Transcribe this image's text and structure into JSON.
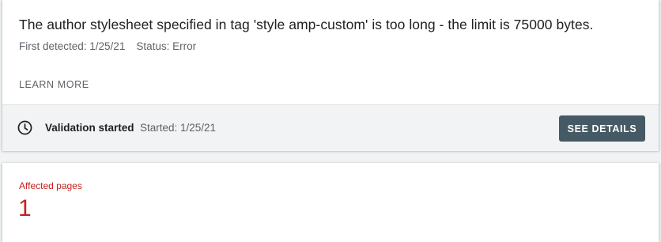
{
  "issue": {
    "title": "The author stylesheet specified in tag 'style amp-custom' is too long - the limit is 75000 bytes.",
    "first_detected": "First detected: 1/25/21",
    "status": "Status: Error",
    "learn_more": "LEARN MORE"
  },
  "validation": {
    "icon": "clock-icon",
    "label": "Validation started",
    "started": "Started: 1/25/21",
    "button_label": "SEE DETAILS",
    "button_color": "#455a64"
  },
  "affected": {
    "label": "Affected pages",
    "count": "1",
    "color": "#c5221f"
  }
}
